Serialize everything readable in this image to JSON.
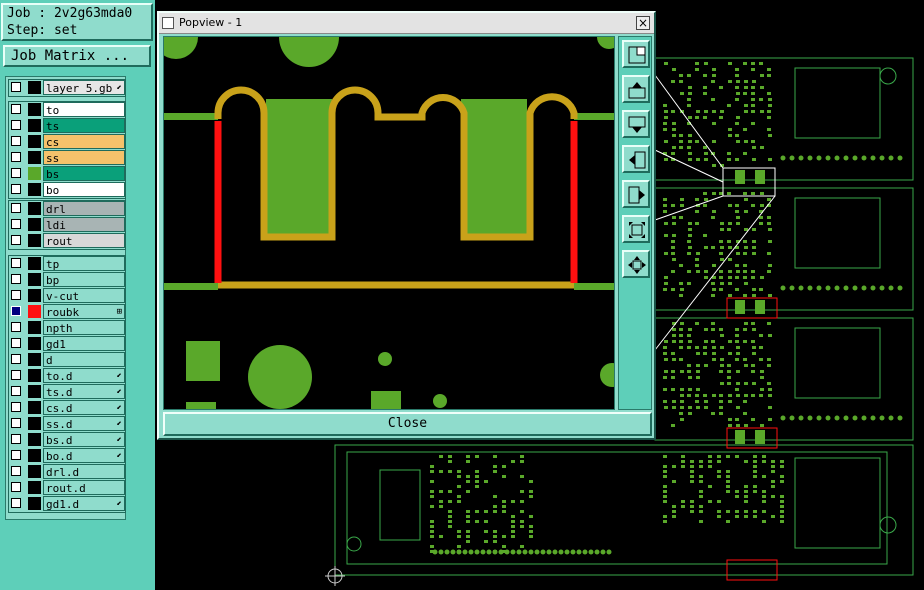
{
  "job": {
    "job_text": "Job : 2v2g63mda0",
    "step_text": "Step: set"
  },
  "job_matrix_label": "Job Matrix ...",
  "groups": [
    {
      "layers": [
        {
          "name": "layer_5.gb",
          "color": "#e6e6e6",
          "mark": "⬋"
        }
      ]
    },
    {
      "layers": [
        {
          "name": "to",
          "color": "#ffffff"
        },
        {
          "name": "ts",
          "color": "#0aa07a",
          "swatch": "#000000"
        },
        {
          "name": "cs",
          "color": "#f5c26b"
        },
        {
          "name": "ss",
          "color": "#f5c26b"
        },
        {
          "name": "bs",
          "color": "#0aa07a",
          "swatch": "#5aa82a"
        },
        {
          "name": "bo",
          "color": "#ffffff"
        }
      ]
    },
    {
      "layers": [
        {
          "name": "drl",
          "color": "#a8b4b4"
        },
        {
          "name": "ldi",
          "color": "#a8b4b4"
        },
        {
          "name": "rout",
          "color": "#d8d8d8"
        }
      ]
    },
    {
      "layers": [
        {
          "name": "tp",
          "color": "#8fdccc"
        },
        {
          "name": "bp",
          "color": "#8fdccc"
        },
        {
          "name": "v-cut",
          "color": "#8fdccc"
        },
        {
          "name": "roubk",
          "color": "#8fdccc",
          "swatch": "#ff1010",
          "active": true,
          "mark": "⊞"
        },
        {
          "name": "npth",
          "color": "#8fdccc"
        },
        {
          "name": "gd1",
          "color": "#8fdccc"
        },
        {
          "name": "d",
          "color": "#8fdccc"
        },
        {
          "name": "to.d",
          "color": "#8fdccc",
          "mark": "⬋"
        },
        {
          "name": "ts.d",
          "color": "#8fdccc",
          "mark": "⬋"
        },
        {
          "name": "cs.d",
          "color": "#8fdccc",
          "mark": "⬋"
        },
        {
          "name": "ss.d",
          "color": "#8fdccc",
          "mark": "⬋"
        },
        {
          "name": "bs.d",
          "color": "#8fdccc",
          "mark": "⬋"
        },
        {
          "name": "bo.d",
          "color": "#8fdccc",
          "mark": "⬋"
        },
        {
          "name": "drl.d",
          "color": "#8fdccc"
        },
        {
          "name": "rout.d",
          "color": "#8fdccc"
        },
        {
          "name": "gd1.d",
          "color": "#8fdccc",
          "mark": "⬋"
        }
      ]
    }
  ],
  "popup": {
    "title": "Popview - 1",
    "close_label": "Close",
    "close_x": "×"
  },
  "tools": [
    {
      "name": "zoom-to-fit-icon"
    },
    {
      "name": "pan-up-icon"
    },
    {
      "name": "pan-down-icon"
    },
    {
      "name": "pan-left-icon"
    },
    {
      "name": "pan-right-icon"
    },
    {
      "name": "zoom-out-icon"
    },
    {
      "name": "zoom-in-icon"
    }
  ],
  "colors": {
    "panel": "#5ecfb9",
    "panel_light": "#8fdccc",
    "pad_green": "#5aa82a",
    "outline_gold": "#c9a21a",
    "highlight_red": "#ff1010",
    "board_outline": "#3aa84a"
  }
}
